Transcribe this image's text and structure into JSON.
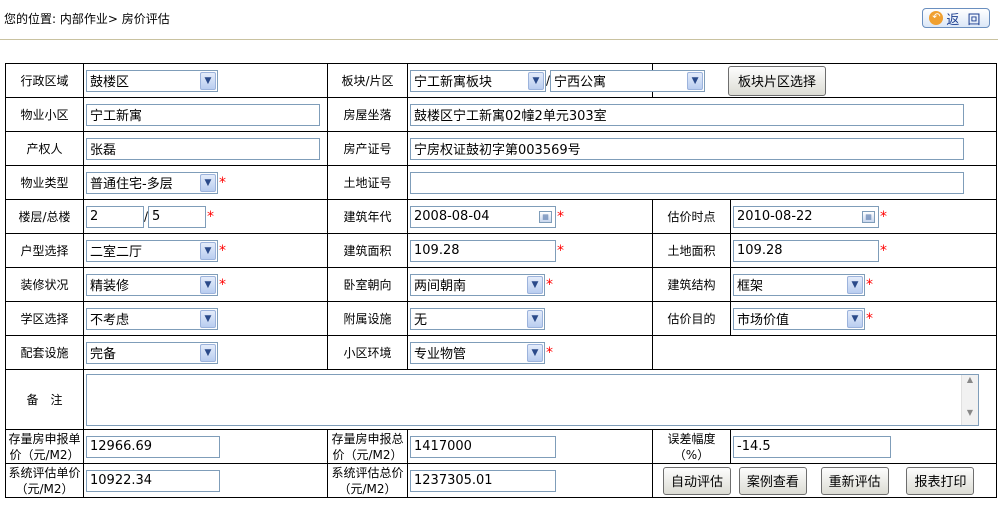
{
  "header": {
    "breadcrumb": "您的位置: 内部作业> 房价评估",
    "back_label": "返 回",
    "back_icon": "back-circle-icon"
  },
  "form": {
    "district_label": "行政区域",
    "district_value": "鼓楼区",
    "block_label": "板块/片区",
    "block_value": "宁工新寓板块",
    "area_value": "宁西公寓",
    "block_select_button": "板块片区选择",
    "community_label": "物业小区",
    "community_value": "宁工新寓",
    "address_label": "房屋坐落",
    "address_value": "鼓楼区宁工新寓02幢2单元303室",
    "owner_label": "产权人",
    "owner_value": "张磊",
    "cert_label": "房产证号",
    "cert_value": "宁房权证鼓初字第003569号",
    "property_type_label": "物业类型",
    "property_type_value": "普通住宅-多层",
    "land_cert_label": "土地证号",
    "land_cert_value": "",
    "floor_label": "楼层/总楼",
    "floor_value": "2",
    "total_floor_value": "5",
    "build_year_label": "建筑年代",
    "build_year_value": "2008-08-04",
    "eval_time_label": "估价时点",
    "eval_time_value": "2010-08-22",
    "layout_label": "户型选择",
    "layout_value": "二室二厅",
    "build_area_label": "建筑面积",
    "build_area_value": "109.28",
    "land_area_label": "土地面积",
    "land_area_value": "109.28",
    "decoration_label": "装修状况",
    "decoration_value": "精装修",
    "orientation_label": "卧室朝向",
    "orientation_value": "两间朝南",
    "structure_label": "建筑结构",
    "structure_value": "框架",
    "school_label": "学区选择",
    "school_value": "不考虑",
    "facility_label": "附属设施",
    "facility_value": "无",
    "purpose_label": "估价目的",
    "purpose_value": "市场价值",
    "support_label": "配套设施",
    "support_value": "完备",
    "env_label": "小区环境",
    "env_value": "专业物管",
    "remark_label": "备　注",
    "remark_value": "",
    "stock_unit_label": "存量房申报单价（元/M2）",
    "stock_unit_value": "12966.69",
    "stock_total_label": "存量房申报总价（元/M2）",
    "stock_total_value": "1417000",
    "error_label": "误差幅度（%）",
    "error_value": "-14.5",
    "sys_unit_label": "系统评估单价（元/M2）",
    "sys_unit_value": "10922.34",
    "sys_total_label": "系统评估总价（元/M2）",
    "sys_total_value": "1237305.01",
    "required_mark": "*"
  },
  "actions": {
    "auto_eval": "自动评估",
    "case_view": "案例查看",
    "re_eval": "重新评估",
    "print_report": "报表打印"
  },
  "colors": {
    "required": "#ff0000",
    "input_border": "#7f9db9",
    "back_text": "#1a3d8f"
  }
}
